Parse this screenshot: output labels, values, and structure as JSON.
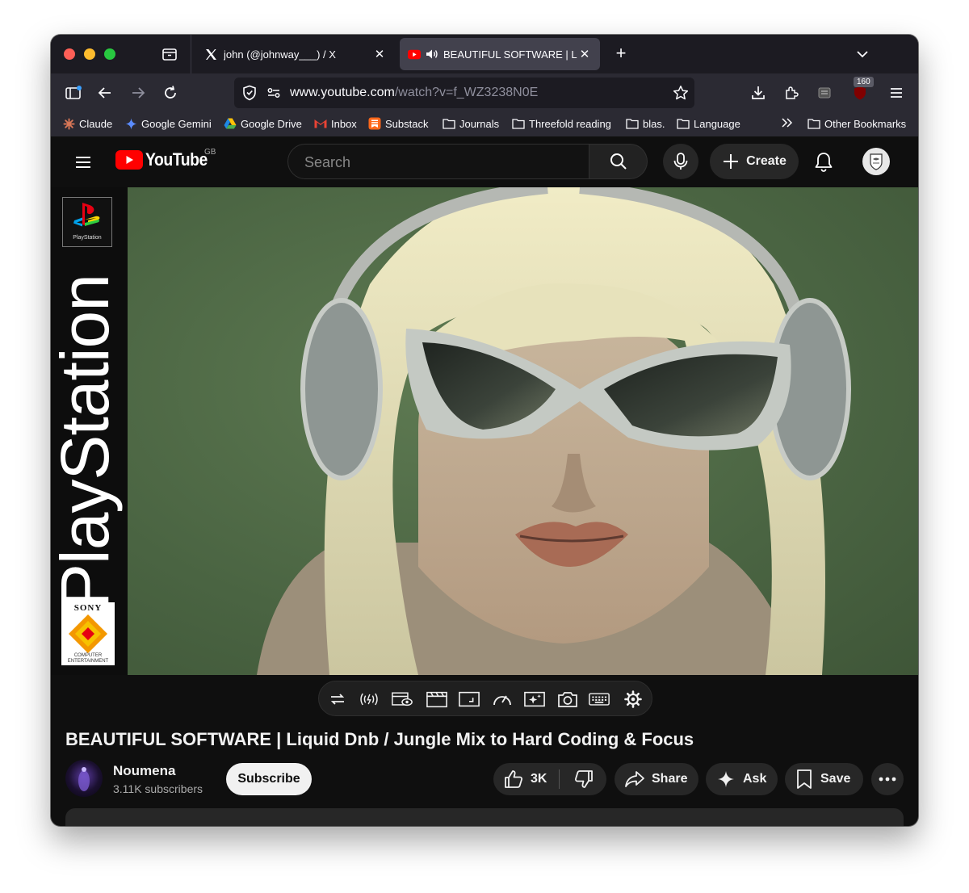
{
  "browser": {
    "tabs": [
      {
        "title": "john (@johnway___) / X"
      },
      {
        "title": "BEAUTIFUL SOFTWARE | Liq"
      }
    ],
    "url": {
      "host": "www.youtube.com",
      "path": "/watch?v=f_WZ3238N0E"
    },
    "extension_badge": "160",
    "bookmarks": [
      {
        "label": "Claude"
      },
      {
        "label": "Google Gemini"
      },
      {
        "label": "Google Drive"
      },
      {
        "label": "Inbox"
      },
      {
        "label": "Substack"
      },
      {
        "label": "Journals"
      },
      {
        "label": "Threefold reading"
      },
      {
        "label": "blas."
      },
      {
        "label": "Language"
      },
      {
        "label": "Other Bookmarks"
      }
    ]
  },
  "youtube": {
    "logo_text": "YouTube",
    "region": "GB",
    "search_placeholder": "Search",
    "create_label": "Create"
  },
  "video": {
    "cover_brand": "PlayStation",
    "cover_badge": "PlayStation",
    "cover_publisher": "SONY",
    "cover_publisher_sub": "COMPUTER ENTERTAINMENT",
    "title": "BEAUTIFUL SOFTWARE | Liquid Dnb / Jungle Mix to Hard Coding & Focus"
  },
  "channel": {
    "name": "Noumena",
    "subscribers": "3.11K subscribers",
    "subscribe_label": "Subscribe"
  },
  "actions": {
    "likes": "3K",
    "share_label": "Share",
    "ask_label": "Ask",
    "save_label": "Save"
  },
  "colors": {
    "yt_red": "#ff0000",
    "tab_strip": "#1c1b22",
    "toolbar": "#2b2a33",
    "page_bg": "#0f0f0f"
  }
}
